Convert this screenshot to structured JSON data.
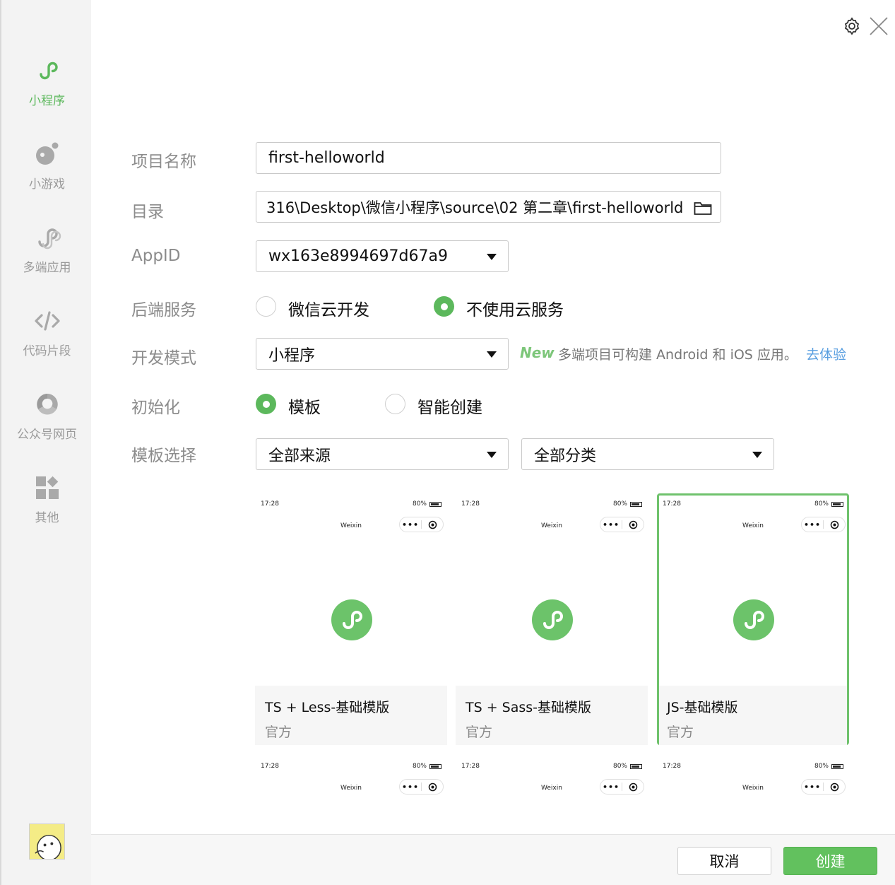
{
  "sidebar": {
    "items": [
      {
        "label": "小程序",
        "icon": "mini-program-icon",
        "active": true
      },
      {
        "label": "小游戏",
        "icon": "mini-game-icon"
      },
      {
        "label": "多端应用",
        "icon": "multi-platform-icon"
      },
      {
        "label": "代码片段",
        "icon": "code-snippet-icon"
      },
      {
        "label": "公众号网页",
        "icon": "official-account-web-icon"
      },
      {
        "label": "其他",
        "icon": "other-grid-icon"
      }
    ]
  },
  "form": {
    "project_name": {
      "label": "项目名称",
      "value": "first-helloworld"
    },
    "directory": {
      "label": "目录",
      "value": "316\\Desktop\\微信小程序\\source\\02 第二章\\first-helloworld"
    },
    "appid": {
      "label": "AppID",
      "value": "wx163e8994697d67a9"
    },
    "backend": {
      "label": "后端服务",
      "option1": "微信云开发",
      "option2": "不使用云服务",
      "selected": "不使用云服务"
    },
    "dev_mode": {
      "label": "开发模式",
      "value": "小程序",
      "new_tag": "New",
      "hint": "多端项目可构建 Android 和 iOS 应用。",
      "link": "去体验"
    },
    "init": {
      "label": "初始化",
      "option1": "模板",
      "option2": "智能创建",
      "selected": "模板"
    },
    "template": {
      "label": "模板选择",
      "source": "全部来源",
      "category": "全部分类"
    }
  },
  "phone_preview": {
    "time": "17:28",
    "battery": "80%",
    "title": "Weixin",
    "dots": "•••"
  },
  "templates": [
    {
      "title": "TS + Less-基础模版",
      "sub": "官方"
    },
    {
      "title": "TS + Sass-基础模版",
      "sub": "官方"
    },
    {
      "title": "JS-基础模版",
      "sub": "官方",
      "selected": true
    }
  ],
  "footer": {
    "cancel": "取消",
    "create": "创建"
  },
  "colors": {
    "accent": "#62c15e",
    "link": "#5a9fe0",
    "label": "#8c8c8c"
  }
}
